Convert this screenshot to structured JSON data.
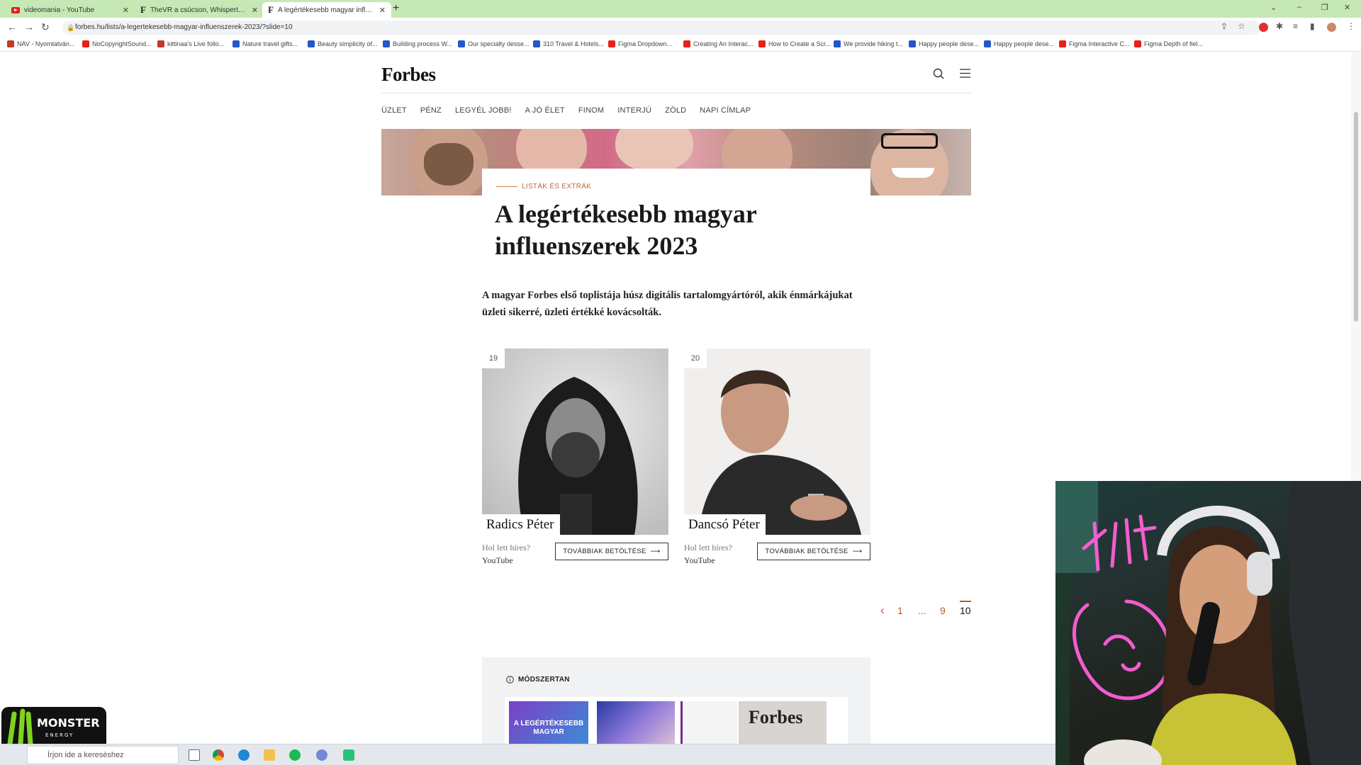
{
  "browser": {
    "tabs": [
      {
        "label": "videomania - YouTube",
        "icon": "youtube-icon"
      },
      {
        "label": "TheVR a csúcson, Whisperton dö",
        "icon": "forbes-icon"
      },
      {
        "label": "A legértékesebb magyar influen",
        "icon": "forbes-icon"
      }
    ],
    "active_tab": 2,
    "url": "forbes.hu/lists/a-legertekesebb-magyar-influenszerek-2023/?slide=10",
    "bookmarks": [
      {
        "label": "NAV - Nyomtatván...",
        "icon": "nav-icon"
      },
      {
        "label": "NoCopyrightSound...",
        "icon": "youtube-icon"
      },
      {
        "label": "kittinaa's Live follo...",
        "icon": "kick-icon"
      },
      {
        "label": "Nature travel gifts...",
        "icon": "notion-icon"
      },
      {
        "label": "Beauty simplicity of...",
        "icon": "notion-icon"
      },
      {
        "label": "Building process W...",
        "icon": "notion-icon"
      },
      {
        "label": "Our specialty desse...",
        "icon": "notion-icon"
      },
      {
        "label": "310 Travel & Hotels...",
        "icon": "notion-icon"
      },
      {
        "label": "Figma Dropdown...",
        "icon": "youtube-icon"
      },
      {
        "label": "Creating An Interac...",
        "icon": "youtube-icon"
      },
      {
        "label": "How to Create a Scr...",
        "icon": "youtube-icon"
      },
      {
        "label": "We provide hiking t...",
        "icon": "notion-icon"
      },
      {
        "label": "Happy people dese...",
        "icon": "notion-icon"
      },
      {
        "label": "Happy people dese...",
        "icon": "notion-icon"
      },
      {
        "label": "Figma Interactive C...",
        "icon": "youtube-icon"
      },
      {
        "label": "Figma Depth of fiel...",
        "icon": "youtube-icon"
      }
    ]
  },
  "site": {
    "logo": "Forbes",
    "nav": [
      "ÜZLET",
      "PÉNZ",
      "LEGYÉL JOBB!",
      "A JÓ ÉLET",
      "FINOM",
      "INTERJÚ",
      "ZÖLD",
      "NAPI CÍMLAP"
    ]
  },
  "article": {
    "kicker": "LISTÁK ÉS EXTRÁK",
    "title": "A legértékesebb magyar influenszerek 2023",
    "intro": "A magyar Forbes első toplistája húsz digitális tartalomgyártóról, akik énmárkájukat üzleti sikerré, üzleti értékké kovácsolták."
  },
  "people": [
    {
      "rank": "19",
      "name": "Radics Péter",
      "question": "Hol lett híres?",
      "source": "YouTube",
      "button": "TOVÁBBIAK BETÖLTÉSE"
    },
    {
      "rank": "20",
      "name": "Dancsó Péter",
      "question": "Hol lett híres?",
      "source": "YouTube",
      "button": "TOVÁBBIAK BETÖLTÉSE"
    }
  ],
  "pagination": {
    "prev": "‹",
    "pages": [
      "1",
      "...",
      "9",
      "10"
    ],
    "current": "10"
  },
  "methodology": {
    "label": "MÓDSZERTAN",
    "cover_text_1": "A LEGÉRTÉKESEBB MAGYAR",
    "cover_text_2": "Forbes"
  },
  "taskbar": {
    "search_placeholder": "Írjon ide a kereséshez"
  },
  "overlay": {
    "logo_text": "MONSTER",
    "logo_sub": "ENERGY"
  },
  "colors": {
    "tabbar": "#c5e8b4",
    "kicker": "#b46a3c",
    "pager_accent": "#c0572f"
  }
}
